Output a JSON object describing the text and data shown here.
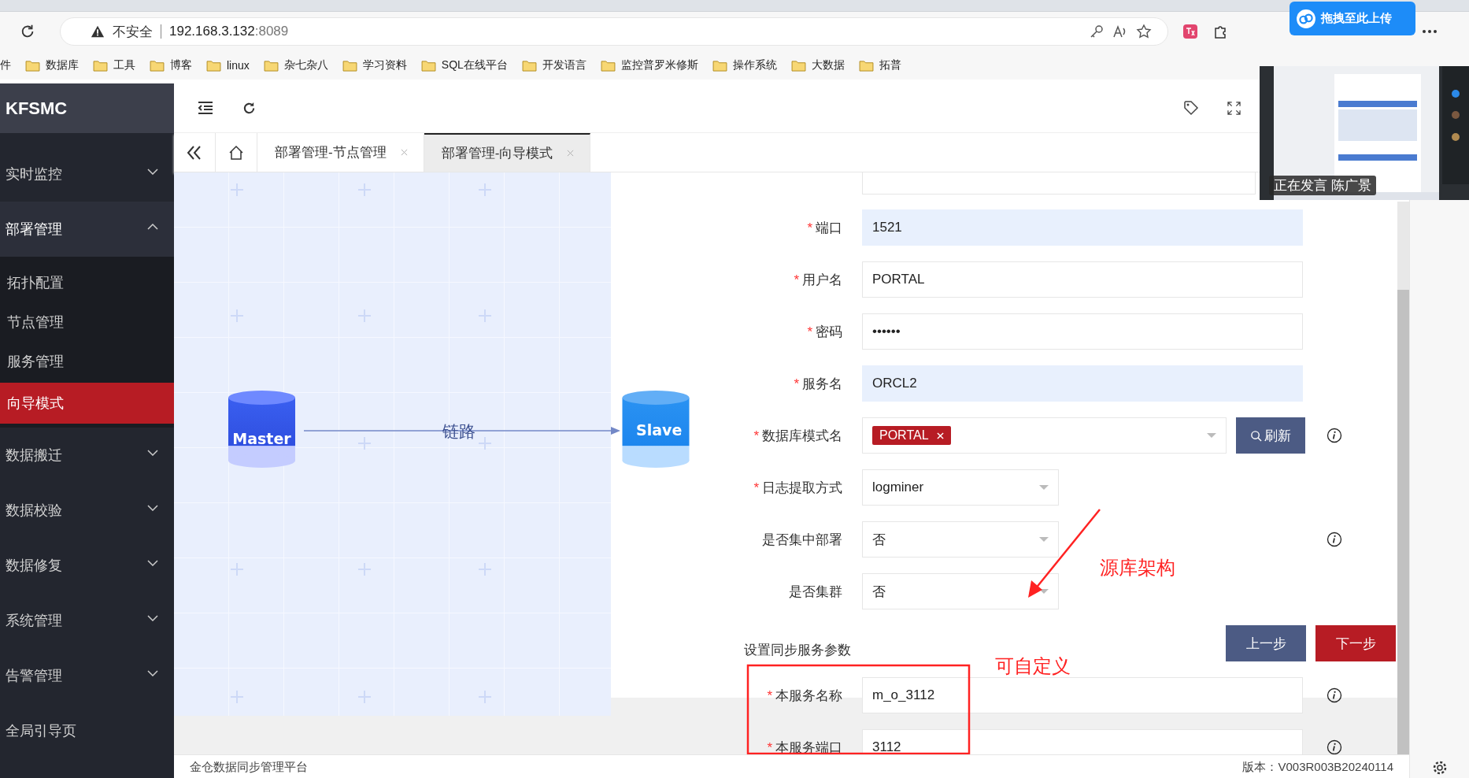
{
  "browser": {
    "address": {
      "warning": "不安全",
      "host": "192.168.3.132",
      "port": ":8089"
    },
    "upload_badge": "拖拽至此上传",
    "bookmarks": [
      "件",
      "数据库",
      "工具",
      "博客",
      "linux",
      "杂七杂八",
      "学习资料",
      "SQL在线平台",
      "开发语言",
      "监控普罗米修斯",
      "操作系统",
      "大数据",
      "拓普"
    ]
  },
  "video_overlay": {
    "kind": "picture",
    "caption": "正在发言 陈广景"
  },
  "app": {
    "logo": "KFSMC",
    "sidebar": [
      {
        "label": "实时监控",
        "kind": "group",
        "expanded": false
      },
      {
        "label": "部署管理",
        "kind": "group",
        "expanded": true,
        "children": [
          {
            "label": "拓扑配置",
            "selected": false
          },
          {
            "label": "节点管理",
            "selected": false
          },
          {
            "label": "服务管理",
            "selected": false
          },
          {
            "label": "向导模式",
            "selected": true
          }
        ]
      },
      {
        "label": "数据搬迁",
        "kind": "group",
        "expanded": false
      },
      {
        "label": "数据校验",
        "kind": "group",
        "expanded": false
      },
      {
        "label": "数据修复",
        "kind": "group",
        "expanded": false
      },
      {
        "label": "系统管理",
        "kind": "group",
        "expanded": false
      },
      {
        "label": "告警管理",
        "kind": "group",
        "expanded": false
      },
      {
        "label": "全局引导页",
        "kind": "link"
      }
    ],
    "tabs": [
      {
        "label": "部署管理-节点管理",
        "selected": false
      },
      {
        "label": "部署管理-向导模式",
        "selected": true
      }
    ],
    "diagram": {
      "source": "Master",
      "target": "Slave",
      "link": "链路"
    },
    "form": {
      "required_mark": "*",
      "fields": [
        {
          "label": "端口",
          "required": true,
          "kind": "text",
          "value": "1521",
          "autofilled": true,
          "info": false
        },
        {
          "label": "用户名",
          "required": true,
          "kind": "text",
          "value": "PORTAL",
          "autofilled": false,
          "info": false
        },
        {
          "label": "密码",
          "required": true,
          "kind": "password",
          "value": "••••••",
          "autofilled": false,
          "info": false
        },
        {
          "label": "服务名",
          "required": true,
          "kind": "text",
          "value": "ORCL2",
          "autofilled": true,
          "info": false
        },
        {
          "label": "数据库模式名",
          "required": true,
          "kind": "tags",
          "tags": [
            "PORTAL"
          ],
          "button": "刷新",
          "info": true
        },
        {
          "label": "日志提取方式",
          "required": true,
          "kind": "select",
          "value": "logminer",
          "info": false
        },
        {
          "label": "是否集中部署",
          "required": false,
          "kind": "select",
          "value": "否",
          "info": true
        },
        {
          "label": "是否集群",
          "required": false,
          "kind": "select",
          "value": "否",
          "info": false
        }
      ],
      "section_title": "设置同步服务参数",
      "buttons": [
        {
          "label": "上一步",
          "kind": "secondary"
        },
        {
          "label": "下一步",
          "kind": "primary"
        }
      ],
      "service_fields": [
        {
          "label": "本服务名称",
          "required": true,
          "kind": "text",
          "value": "m_o_3112",
          "autofilled": false,
          "info": true
        },
        {
          "label": "本服务端口",
          "required": true,
          "kind": "text",
          "value": "3112",
          "autofilled": false,
          "info": true
        }
      ]
    },
    "footer": {
      "left": "金仓数据同步管理平台",
      "right": "版本：V003R003B20240114"
    }
  },
  "annotations": [
    {
      "text": "源库架构"
    },
    {
      "text": "可自定义"
    }
  ]
}
